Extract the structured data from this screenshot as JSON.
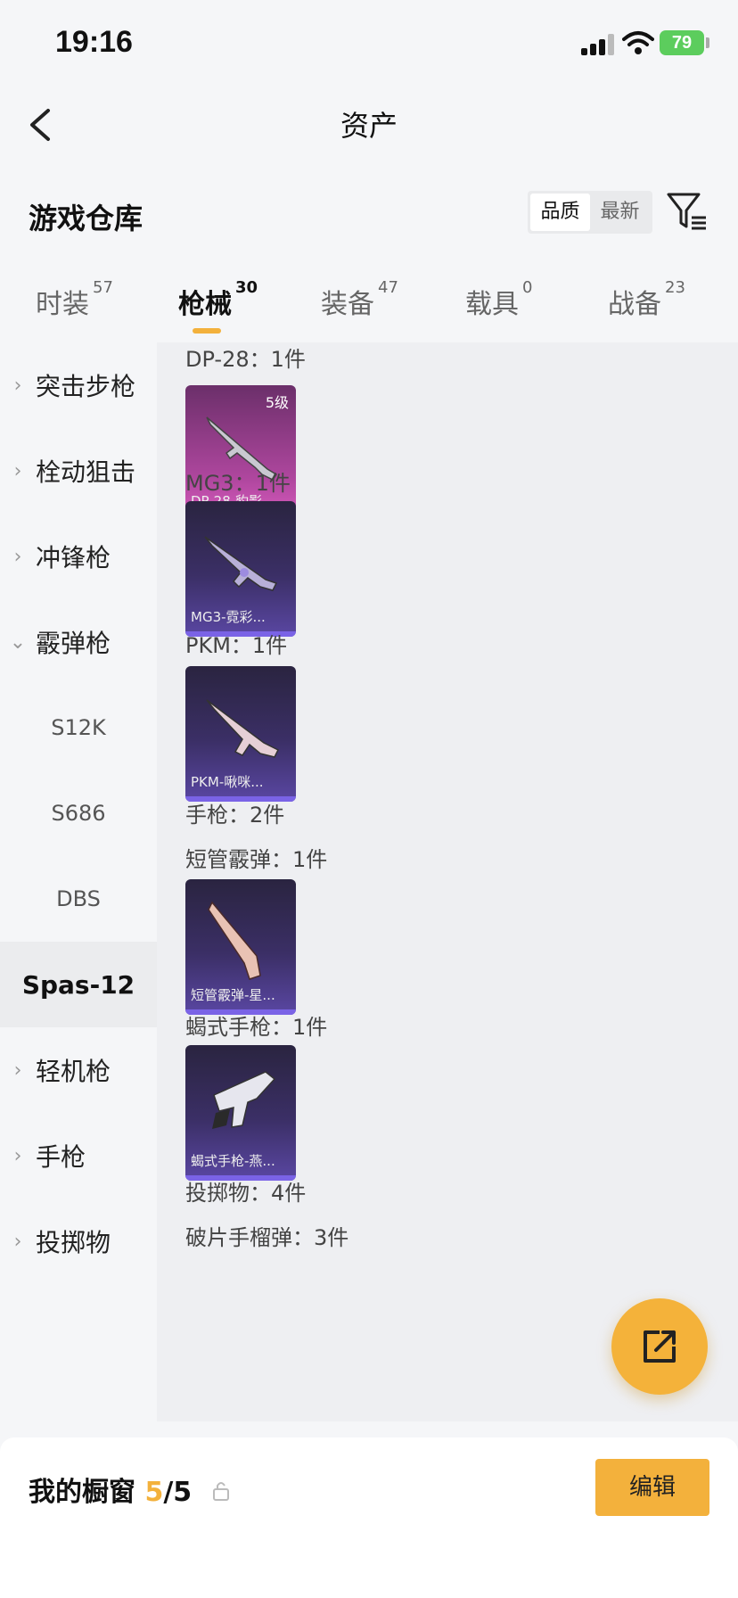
{
  "status": {
    "time": "19:16",
    "battery": "79"
  },
  "nav": {
    "title": "资产"
  },
  "section": {
    "title": "游戏仓库",
    "sort_quality": "品质",
    "sort_latest": "最新"
  },
  "tabs": [
    {
      "label": "时装",
      "count": "57"
    },
    {
      "label": "枪械",
      "count": "30"
    },
    {
      "label": "装备",
      "count": "47"
    },
    {
      "label": "载具",
      "count": "0"
    },
    {
      "label": "战备",
      "count": "23"
    }
  ],
  "sidebar": [
    {
      "label": "突击步枪"
    },
    {
      "label": "栓动狙击"
    },
    {
      "label": "冲锋枪"
    },
    {
      "label": "霰弹枪"
    },
    {
      "label": "S12K"
    },
    {
      "label": "S686"
    },
    {
      "label": "DBS"
    },
    {
      "label": "Spas-12"
    },
    {
      "label": "轻机枪"
    },
    {
      "label": "手枪"
    },
    {
      "label": "投掷物"
    }
  ],
  "content": {
    "groups": [
      {
        "label": "DP-28：1件"
      },
      {
        "label": "MG3：1件"
      },
      {
        "label": "PKM：1件"
      },
      {
        "label": "手枪：2件"
      },
      {
        "label": "短管霰弹：1件"
      },
      {
        "label": "蝎式手枪：1件"
      },
      {
        "label": "投掷物：4件"
      },
      {
        "label": "破片手榴弹：3件"
      }
    ],
    "cards": [
      {
        "name": "DP-28-豹影...",
        "level": "5级",
        "rarity_color": "#b0479f"
      },
      {
        "name": "MG3-霓彩...",
        "rarity_color": "#5a47a3"
      },
      {
        "name": "PKM-啾咪...",
        "rarity_color": "#5a47a3"
      },
      {
        "name": "短管霰弹-星...",
        "rarity_color": "#5a47a3"
      },
      {
        "name": "蝎式手枪-燕...",
        "rarity_color": "#5a47a3"
      }
    ]
  },
  "showcase": {
    "title": "我的橱窗",
    "used": "5",
    "total": "/5",
    "edit_label": "编辑"
  },
  "icons": [
    "back-arrow-icon",
    "filter-icon",
    "lock-icon",
    "share-external-icon",
    "chevron-right-icon",
    "chevron-down-icon"
  ],
  "colors": {
    "accent": "#f3b13c",
    "battery": "#5ccd5d"
  }
}
